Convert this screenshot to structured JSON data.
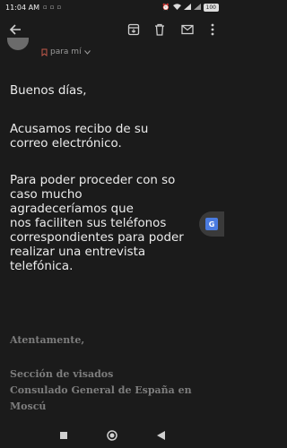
{
  "status_bar": {
    "time": "11:04 AM",
    "battery": "100"
  },
  "icons": {
    "back": "arrow-back-icon",
    "archive": "archive-icon",
    "delete": "trash-icon",
    "mail": "mail-icon",
    "more": "more-vert-icon",
    "translate": "translate-icon"
  },
  "email": {
    "recipient": "para mí",
    "greeting": "Buenos días,",
    "para1": "Acusamos recibo de su\ncorreo electrónico.",
    "para2": "Para poder proceder con so\ncaso mucho\nagradeceríamos que\n nos faciliten sus teléfonos\ncorrespondientes para poder\nrealizar una entrevista\ntelefónica.",
    "closing": "Atentamente,",
    "signature": "Sección de visados\nConsulado General de España en\nMoscú"
  },
  "colors": {
    "background": "#1b1b1b",
    "signature": "#7d7d7d",
    "translate_accent": "#4a7be0"
  }
}
